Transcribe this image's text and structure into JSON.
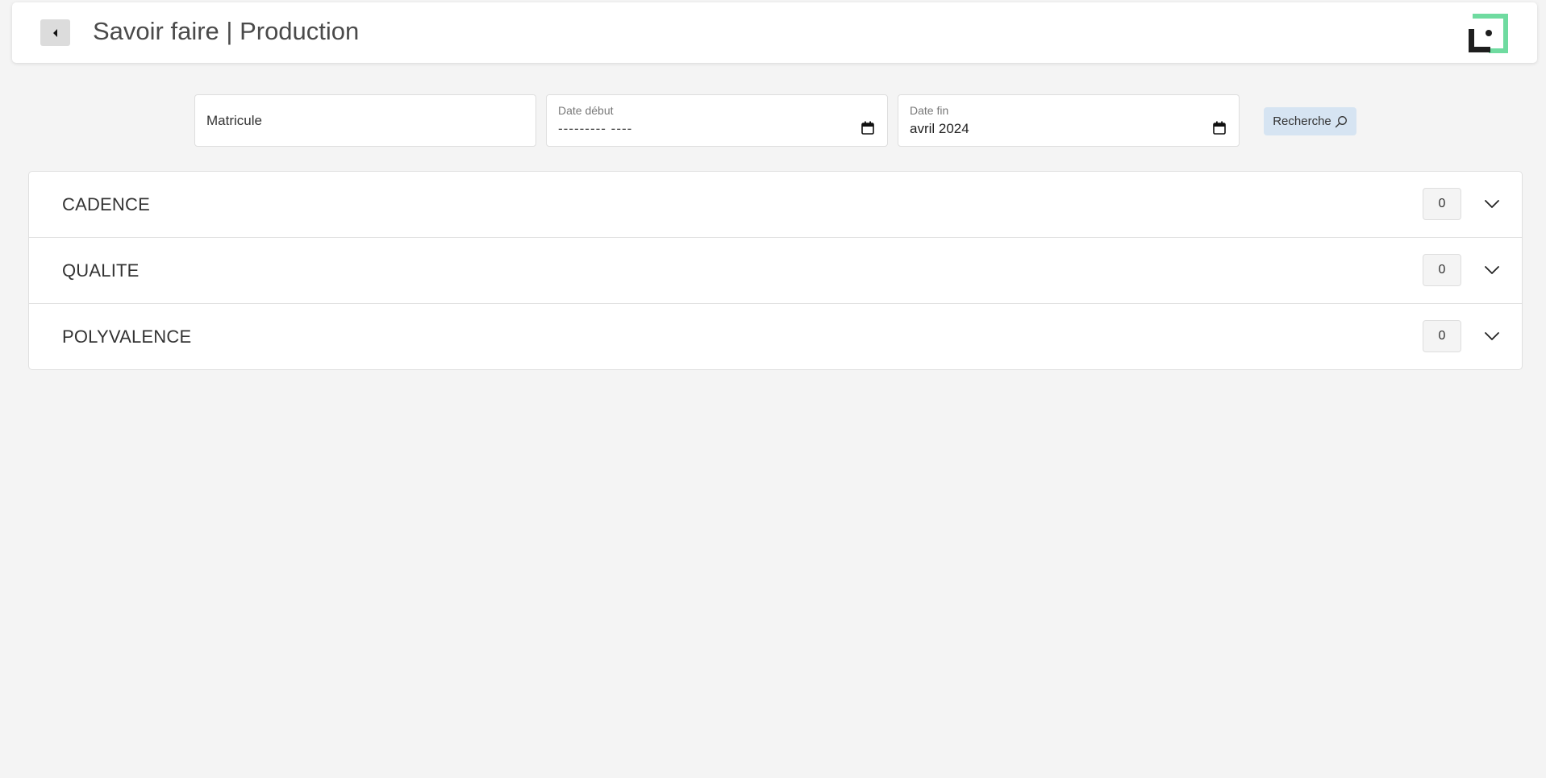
{
  "header": {
    "title": "Savoir faire | Production",
    "back_icon": "caret-left-icon",
    "logo_icon": "brand-logo",
    "logo_colors": {
      "accent": "#6fdba0",
      "dark": "#1e1e1e"
    }
  },
  "filters": {
    "matricule": {
      "placeholder": "Matricule"
    },
    "date_debut": {
      "label": "Date début",
      "value": "--------- ----"
    },
    "date_fin": {
      "label": "Date fin",
      "value": "avril 2024"
    },
    "search_button": {
      "label": "Recherche",
      "icon": "search-icon"
    }
  },
  "sections": [
    {
      "label": "CADENCE",
      "count": "0"
    },
    {
      "label": "QUALITE",
      "count": "0"
    },
    {
      "label": "POLYVALENCE",
      "count": "0"
    }
  ]
}
